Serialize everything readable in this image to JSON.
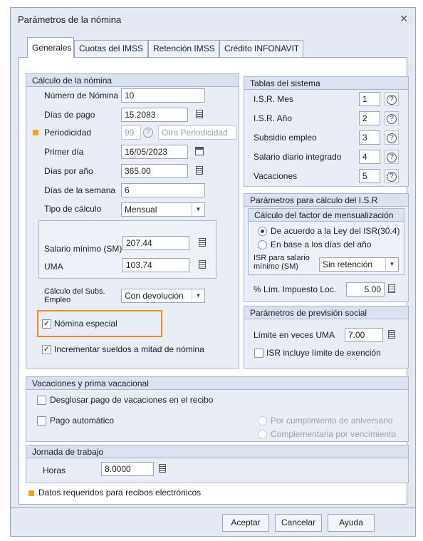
{
  "window": {
    "title": "Parámetros de la nómina",
    "close_glyph": "✕"
  },
  "tabs": [
    "Generales",
    "Cuotas del IMSS",
    "Retención IMSS",
    "Crédito INFONAVIT"
  ],
  "calculo": {
    "header": "Cálculo de la nómina",
    "numero_label": "Número de Nómina",
    "numero_value": "10",
    "dias_pago_label": "Días de pago",
    "dias_pago_value": "15.2083",
    "periodicidad_label": "Periodicidad",
    "periodicidad_value": "99",
    "periodicidad_other": "Otra Periodicidad",
    "primer_dia_label": "Primer día",
    "primer_dia_value": "16/05/2023",
    "dias_anio_label": "Días por año",
    "dias_anio_value": "365.00",
    "dias_semana_label": "Días de la semana",
    "dias_semana_value": "6",
    "tipo_label": "Tipo de cálculo",
    "tipo_value": "Mensual",
    "salario_min_label": "Salario mínimo (SM)",
    "salario_min_value": "207.44",
    "uma_label": "UMA",
    "uma_value": "103.74",
    "subs_label_1": "Cálculo del Subs.",
    "subs_label_2": "Empleo",
    "subs_value": "Con devolución",
    "nomina_especial_label": "Nómina especial",
    "nomina_especial_checked": true,
    "incrementar_label": "Incrementar sueldos a mitad de nómina",
    "incrementar_checked": true
  },
  "tablas": {
    "header": "Tablas del sistema",
    "rows": [
      {
        "label": "I.S.R. Mes",
        "value": "1"
      },
      {
        "label": "I.S.R. Año",
        "value": "2"
      },
      {
        "label": "Subsidio empleo",
        "value": "3"
      },
      {
        "label": "Salario diario integrado",
        "value": "4"
      },
      {
        "label": "Vacaciones",
        "value": "5"
      }
    ]
  },
  "isr": {
    "header": "Parámetros para cálculo del I.S.R",
    "factor_header": "Cálculo del factor de mensualización",
    "radio1": "De acuerdo a la Ley del ISR(30.4)",
    "radio2": "En base a los días del año",
    "isr_sm_label_1": "ISR para salario",
    "isr_sm_label_2": "mínimo (SM)",
    "isr_sm_value": "Sin retención",
    "lim_label": "% Lím. Impuesto Loc.",
    "lim_value": "5.00"
  },
  "prevision": {
    "header": "Parámetros de previsión social",
    "limite_label": "Límite en veces UMA",
    "limite_value": "7.00",
    "isr_incluye_label": "ISR incluye límite de exención"
  },
  "vacaciones": {
    "header": "Vacaciones y prima vacacional",
    "desglosar_label": "Desglosar pago de vacaciones en el recibo",
    "pago_auto_label": "Pago automático",
    "radio_aniversario": "Por cumplimiento de aniversario",
    "radio_vencimiento": "Complementaria por vencimiento"
  },
  "jornada": {
    "header": "Jornada de trabajo",
    "horas_label": "Horas",
    "horas_value": "8.0000"
  },
  "legend": "Datos requeridos para recibos electrónicos",
  "buttons": {
    "aceptar": "Aceptar",
    "cancelar": "Cancelar",
    "ayuda": "Ayuda"
  },
  "colors": {
    "required_marker": "#f4a51c",
    "highlight": "#f28a1d"
  }
}
